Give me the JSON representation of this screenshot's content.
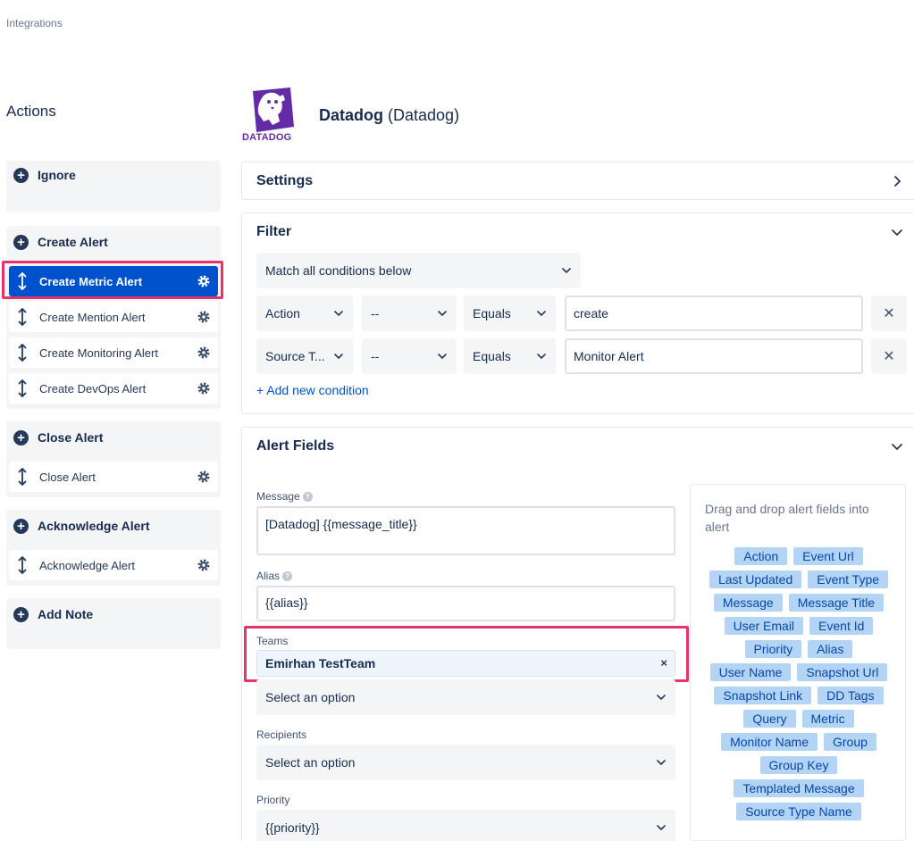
{
  "breadcrumb": "Integrations",
  "actions": {
    "title": "Actions",
    "groups": {
      "ignore": {
        "label": "Ignore"
      },
      "create": {
        "label": "Create Alert",
        "items": [
          "Create Metric Alert",
          "Create Mention Alert",
          "Create Monitoring Alert",
          "Create DevOps Alert"
        ]
      },
      "close": {
        "label": "Close Alert",
        "items": [
          "Close Alert"
        ]
      },
      "acknowledge": {
        "label": "Acknowledge Alert",
        "items": [
          "Acknowledge Alert"
        ]
      },
      "note": {
        "label": "Add Note"
      }
    }
  },
  "integration": {
    "logo_text": "DATADOG",
    "name": "Datadog",
    "type": "(Datadog)"
  },
  "settings": {
    "title": "Settings"
  },
  "filter": {
    "title": "Filter",
    "match": "Match all conditions below",
    "conditions": [
      {
        "field": "Action",
        "not": "--",
        "op": "Equals",
        "value": "create"
      },
      {
        "field": "Source T...",
        "not": "--",
        "op": "Equals",
        "value": "Monitor Alert"
      }
    ],
    "add_condition": "+ Add new condition"
  },
  "alert_fields": {
    "title": "Alert Fields",
    "message": {
      "label": "Message",
      "value": "[Datadog] {{message_title}}"
    },
    "alias": {
      "label": "Alias",
      "value": "{{alias}}"
    },
    "teams": {
      "label": "Teams",
      "tag": "Emirhan TestTeam",
      "remove": "×",
      "placeholder": "Select an option"
    },
    "recipients": {
      "label": "Recipients",
      "placeholder": "Select an option"
    },
    "priority": {
      "label": "Priority",
      "value": "{{priority}}"
    },
    "drag_hint": "Drag and drop alert fields into alert",
    "chips": [
      [
        "Action",
        "Event Url"
      ],
      [
        "Last Updated",
        "Event Type"
      ],
      [
        "Message",
        "Message Title"
      ],
      [
        "User Email",
        "Event Id"
      ],
      [
        "Priority",
        "Alias"
      ],
      [
        "User Name",
        "Snapshot Url"
      ],
      [
        "Snapshot Link",
        "DD Tags"
      ],
      [
        "Query",
        "Metric"
      ],
      [
        "Monitor Name",
        "Group"
      ],
      [
        "Group Key"
      ],
      [
        "Templated Message"
      ],
      [
        "Source Type Name"
      ]
    ]
  },
  "colors": {
    "accent": "#0052cc",
    "highlight": "#e8336a",
    "chip_bg": "#b3d4f5",
    "datadog_purple": "#632ca6"
  }
}
